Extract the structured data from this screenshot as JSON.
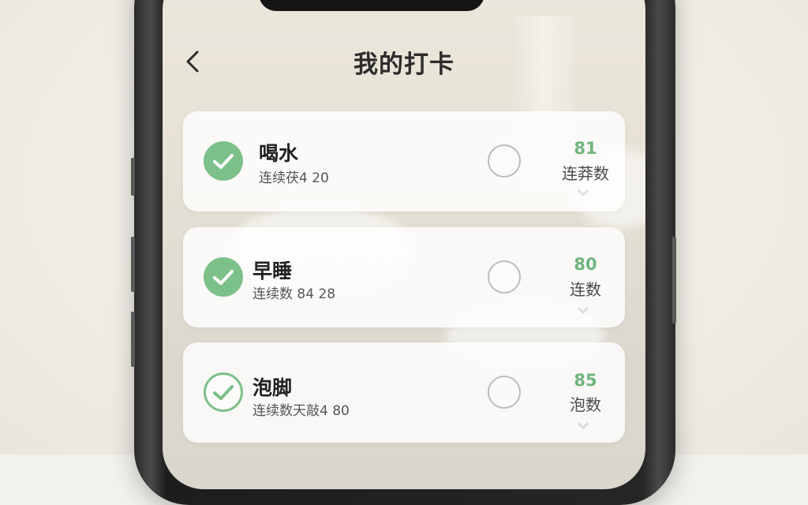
{
  "header": {
    "title": "我的打卡",
    "back_icon": "chevron-left-icon"
  },
  "habits": [
    {
      "name": "喝水",
      "subtitle": "连续茯4 20",
      "checked": true,
      "check_style": "filled",
      "count": "81",
      "count_label": "连莽数"
    },
    {
      "name": "早睡",
      "subtitle": "连续数 84 28",
      "checked": true,
      "check_style": "filled",
      "count": "80",
      "count_label": "连数"
    },
    {
      "name": "泡脚",
      "subtitle": "连续数天敲4 80",
      "checked": true,
      "check_style": "outline",
      "count": "85",
      "count_label": "泡数"
    }
  ],
  "colors": {
    "accent_green": "#7cc08a",
    "count_green": "#6fb57e",
    "title_text": "#2c2c2c"
  }
}
